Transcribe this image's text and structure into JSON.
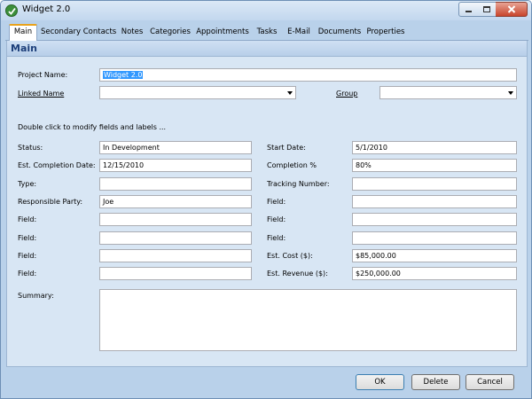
{
  "window": {
    "title": "Widget 2.0"
  },
  "tabs": [
    {
      "label": "Main",
      "active": true
    },
    {
      "label": "Secondary Contacts"
    },
    {
      "label": "Notes"
    },
    {
      "label": "Categories"
    },
    {
      "label": "Appointments"
    },
    {
      "label": "Tasks"
    },
    {
      "label": "E-Mail"
    },
    {
      "label": "Documents"
    },
    {
      "label": "Properties"
    }
  ],
  "panel": {
    "title": "Main"
  },
  "form": {
    "project_name_label": "Project Name:",
    "project_name_value": "Widget 2.0",
    "linked_name_label": "Linked Name",
    "linked_name_value": "",
    "group_label": "Group",
    "group_value": "",
    "hint": "Double click to modify fields and labels ...",
    "left": [
      {
        "label": "Status:",
        "value": "In Development"
      },
      {
        "label": "Est. Completion Date:",
        "value": "12/15/2010"
      },
      {
        "label": "Type:",
        "value": ""
      },
      {
        "label": "Responsible Party:",
        "value": "Joe"
      },
      {
        "label": "Field:",
        "value": ""
      },
      {
        "label": "Field:",
        "value": ""
      },
      {
        "label": "Field:",
        "value": ""
      },
      {
        "label": "Field:",
        "value": ""
      }
    ],
    "right": [
      {
        "label": "Start Date:",
        "value": "5/1/2010"
      },
      {
        "label": "Completion %",
        "value": "80%"
      },
      {
        "label": "Tracking Number:",
        "value": ""
      },
      {
        "label": "Field:",
        "value": ""
      },
      {
        "label": "Field:",
        "value": ""
      },
      {
        "label": "Field:",
        "value": ""
      },
      {
        "label": "Est. Cost ($):",
        "value": "$85,000.00"
      },
      {
        "label": "Est. Revenue ($):",
        "value": "$250,000.00"
      }
    ],
    "summary_label": "Summary:",
    "summary_value": ""
  },
  "buttons": {
    "ok": "OK",
    "delete": "Delete",
    "cancel": "Cancel"
  },
  "colors": {
    "window_bg": "#b9d1ea",
    "panel_bg": "#d8e6f4",
    "panel_title": "#1d3f7a",
    "active_tab_accent": "#e8a21d",
    "selection": "#3399ff"
  }
}
